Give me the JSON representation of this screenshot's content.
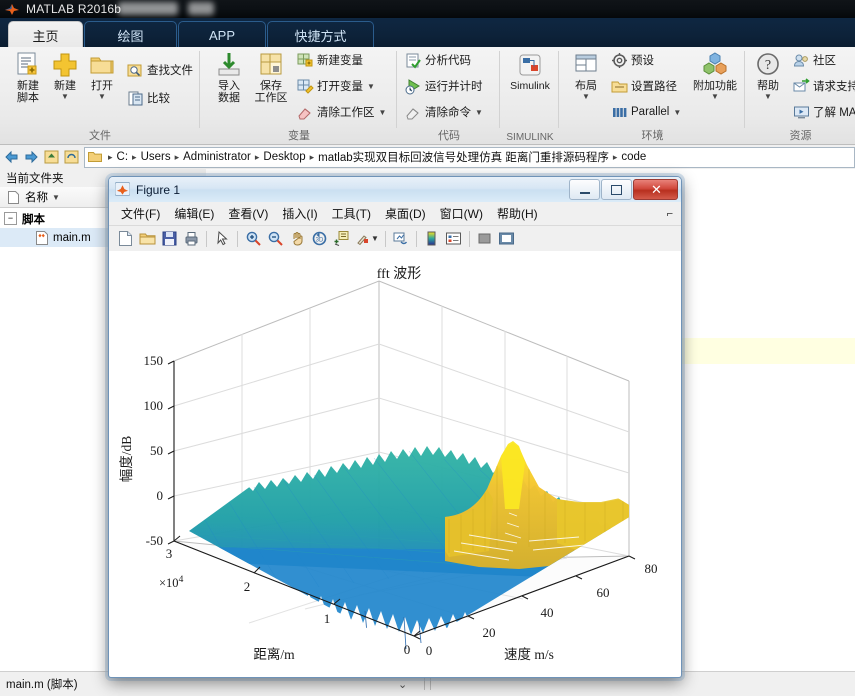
{
  "window": {
    "title": "MATLAB R2016b",
    "app_icon": "matlab-icon"
  },
  "ribbon": {
    "tabs": [
      {
        "label": "主页",
        "selected": true
      },
      {
        "label": "绘图",
        "selected": false
      },
      {
        "label": "APP",
        "selected": false
      },
      {
        "label": "快捷方式",
        "selected": false
      }
    ],
    "groups": [
      {
        "name": "文件",
        "big_buttons": [
          {
            "label_line1": "新建",
            "label_line2": "脚本",
            "icon": "new-script-icon",
            "caret": false
          },
          {
            "label_line1": "新建",
            "label_line2": "",
            "icon": "new-icon",
            "caret": true
          },
          {
            "label_line1": "打开",
            "label_line2": "",
            "icon": "open-folder-icon",
            "caret": true
          }
        ],
        "small_buttons": [
          {
            "label": "查找文件",
            "icon": "find-files-icon",
            "caret": false
          },
          {
            "label": "比较",
            "icon": "compare-icon",
            "caret": false
          }
        ]
      },
      {
        "name": "变量",
        "big_buttons": [
          {
            "label_line1": "导入",
            "label_line2": "数据",
            "icon": "import-data-icon",
            "caret": false
          },
          {
            "label_line1": "保存",
            "label_line2": "工作区",
            "icon": "save-workspace-icon",
            "caret": false
          }
        ],
        "small_buttons": [
          {
            "label": "新建变量",
            "icon": "new-variable-icon",
            "caret": false
          },
          {
            "label": "打开变量",
            "icon": "open-variable-icon",
            "caret": true
          },
          {
            "label": "清除工作区",
            "icon": "clear-workspace-icon",
            "caret": true
          }
        ]
      },
      {
        "name": "代码",
        "big_buttons": [],
        "small_buttons": [
          {
            "label": "分析代码",
            "icon": "analyze-code-icon",
            "caret": false
          },
          {
            "label": "运行并计时",
            "icon": "run-and-time-icon",
            "caret": false
          },
          {
            "label": "清除命令",
            "icon": "clear-commands-icon",
            "caret": true
          }
        ]
      },
      {
        "name": "SIMULINK",
        "big_buttons": [
          {
            "label_line1": "Simulink",
            "label_line2": "",
            "icon": "simulink-icon",
            "caret": false
          }
        ],
        "small_buttons": []
      },
      {
        "name": "环境",
        "big_buttons": [
          {
            "label_line1": "布局",
            "label_line2": "",
            "icon": "layout-icon",
            "caret": true
          },
          {
            "label_line1": "附加功能",
            "label_line2": "",
            "icon": "add-ons-icon",
            "caret": true
          }
        ],
        "small_buttons": [
          {
            "label": "预设",
            "icon": "preferences-gear-icon",
            "caret": false
          },
          {
            "label": "设置路径",
            "icon": "set-path-icon",
            "caret": false
          },
          {
            "label": "Parallel",
            "icon": "parallel-icon",
            "caret": true
          }
        ]
      },
      {
        "name": "资源",
        "big_buttons": [
          {
            "label_line1": "帮助",
            "label_line2": "",
            "icon": "help-question-icon",
            "caret": true
          }
        ],
        "small_buttons": [
          {
            "label": "社区",
            "icon": "community-icon",
            "caret": false
          },
          {
            "label": "请求支持",
            "icon": "request-support-icon",
            "caret": false
          },
          {
            "label": "了解 MA",
            "icon": "learn-matlab-icon",
            "caret": false
          }
        ]
      }
    ]
  },
  "address_bar": {
    "back_icon": "back-arrow-icon",
    "forward_icon": "forward-arrow-icon",
    "up_icon": "up-folder-icon",
    "refresh_icon": "refresh-icon",
    "folder_icon": "folder-icon",
    "crumbs": [
      "C:",
      "Users",
      "Administrator",
      "Desktop",
      "matlab实现双目标回波信号处理仿真 距离门重排源码程序",
      "code"
    ]
  },
  "current_folder": {
    "header": "当前文件夹",
    "column_header": "名称",
    "column_sort_icon": "sort-caret-icon",
    "tree": [
      {
        "label": "脚本",
        "type": "group",
        "expander": "−",
        "icon": "none"
      },
      {
        "label": "main.m",
        "type": "file",
        "icon": "m-file-icon",
        "selected": true
      }
    ]
  },
  "status_bar": {
    "text": "main.m  (脚本)",
    "chevron_icon": "chevron-down-icon"
  },
  "figure_window": {
    "title": "Figure 1",
    "icon": "matlab-figure-icon",
    "window_buttons": [
      {
        "name": "minimize",
        "glyph": "—"
      },
      {
        "name": "maximize",
        "glyph": "□"
      },
      {
        "name": "close",
        "glyph": "✕"
      }
    ],
    "menu": [
      {
        "label": "文件(F)",
        "mnemonic": "F"
      },
      {
        "label": "编辑(E)",
        "mnemonic": "E"
      },
      {
        "label": "查看(V)",
        "mnemonic": "V"
      },
      {
        "label": "插入(I)",
        "mnemonic": "I"
      },
      {
        "label": "工具(T)",
        "mnemonic": "T"
      },
      {
        "label": "桌面(D)",
        "mnemonic": "D"
      },
      {
        "label": "窗口(W)",
        "mnemonic": "W"
      },
      {
        "label": "帮助(H)",
        "mnemonic": "H"
      }
    ],
    "dock_glyph": "⌐",
    "toolbar": [
      {
        "icon": "new-figure-icon"
      },
      {
        "icon": "open-file-icon"
      },
      {
        "icon": "save-figure-icon"
      },
      {
        "icon": "print-figure-icon"
      },
      {
        "sep": true
      },
      {
        "icon": "pointer-select-icon"
      },
      {
        "sep": true
      },
      {
        "icon": "zoom-in-icon"
      },
      {
        "icon": "zoom-out-icon"
      },
      {
        "icon": "pan-hand-icon"
      },
      {
        "icon": "rotate-3d-icon"
      },
      {
        "icon": "data-cursor-icon"
      },
      {
        "icon": "brush-data-icon",
        "caret": true
      },
      {
        "sep": true
      },
      {
        "icon": "link-plot-icon"
      },
      {
        "sep": true
      },
      {
        "icon": "colorbar-icon"
      },
      {
        "icon": "legend-icon"
      },
      {
        "sep": true
      },
      {
        "icon": "hide-plot-tools-icon"
      },
      {
        "icon": "show-plot-tools-icon"
      }
    ]
  },
  "chart_data": {
    "type": "surface",
    "title": "fft 波形",
    "xlabel": "距离/m",
    "ylabel": "速度 m/s",
    "zlabel": "幅度/dB",
    "x_exponent_label": "×10",
    "x_exponent_sup": "4",
    "x_ticks": [
      "3",
      "2",
      "1",
      "0"
    ],
    "x_tick_values": [
      3,
      2,
      1,
      0
    ],
    "xlim": [
      0,
      3
    ],
    "y_ticks": [
      "0",
      "20",
      "40",
      "60",
      "80"
    ],
    "y_tick_values": [
      0,
      20,
      40,
      60,
      80
    ],
    "ylim": [
      0,
      80
    ],
    "z_ticks": [
      "-50",
      "0",
      "50",
      "100",
      "150"
    ],
    "z_tick_values": [
      -50,
      0,
      50,
      100,
      150
    ],
    "zlim": [
      -50,
      150
    ],
    "grid": true,
    "colormap": "parula",
    "view": "3d-mesh",
    "description": "双目标回波 FFT 3D 网格曲面：蓝绿色噪声基底约 30-60 dB，一条黄色高亮速度脊线，峰值约 85 dB",
    "noise_floor_db": 45,
    "peak_db": 85,
    "peak_range_m": 15000,
    "peak_velocity_ms": 38,
    "ridge_color": "#f0c419",
    "noise_color": "#2da7a0",
    "low_color": "#2878c8"
  }
}
